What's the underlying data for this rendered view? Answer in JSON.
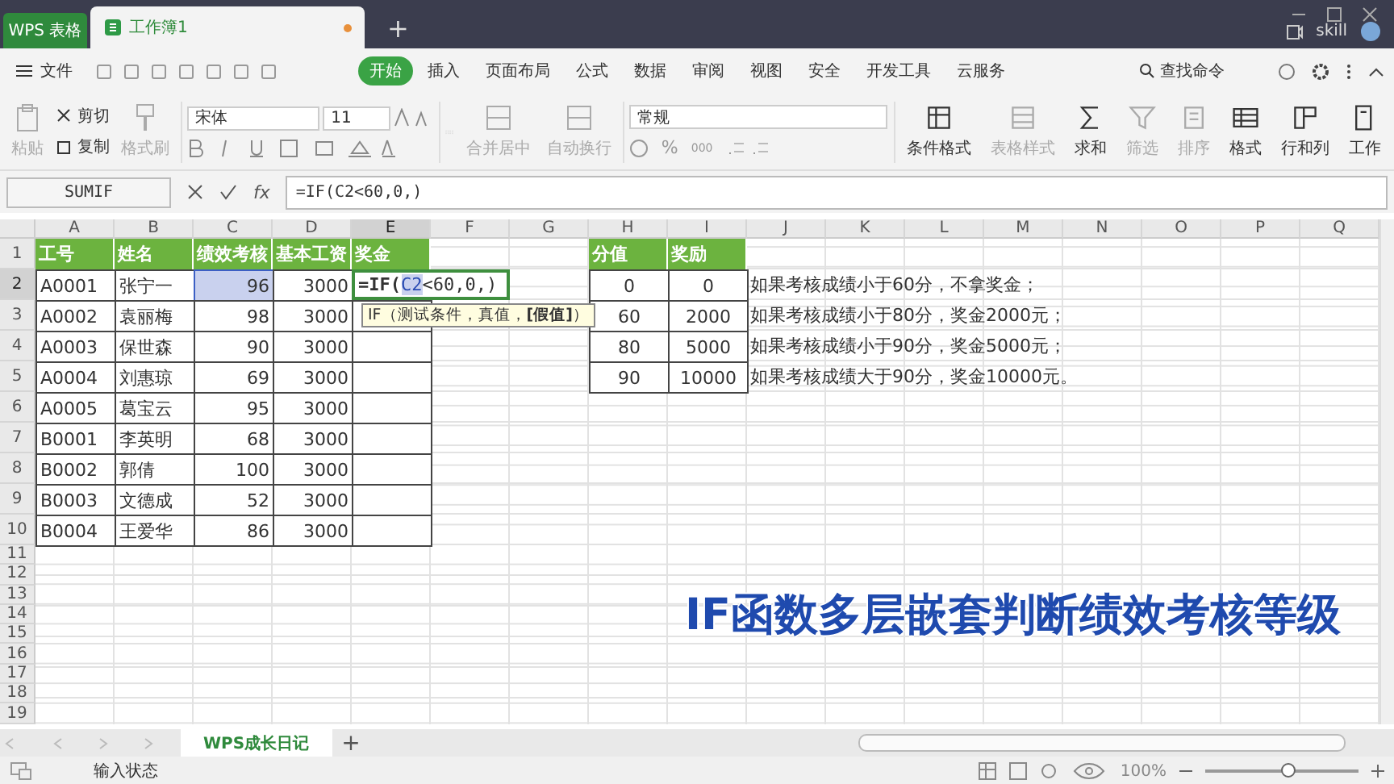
{
  "title_bar": {
    "app_tab": "WPS 表格",
    "doc_tab": {
      "label": "工作簿1",
      "unsaved": true
    },
    "new_tab": "+",
    "user": "skill"
  },
  "menu_bar": {
    "file": "文件",
    "tabs": [
      {
        "label": "开始",
        "selected": true
      },
      {
        "label": "插入",
        "selected": false
      },
      {
        "label": "页面布局",
        "selected": false
      },
      {
        "label": "公式",
        "selected": false
      },
      {
        "label": "数据",
        "selected": false
      },
      {
        "label": "审阅",
        "selected": false
      },
      {
        "label": "视图",
        "selected": false
      },
      {
        "label": "安全",
        "selected": false
      },
      {
        "label": "开发工具",
        "selected": false
      },
      {
        "label": "云服务",
        "selected": false
      }
    ],
    "search": "查找命令"
  },
  "ribbon": {
    "clipboard": [
      {
        "label": "粘贴",
        "disabled": true
      },
      {
        "label": "剪切",
        "disabled": false
      },
      {
        "label": "复制",
        "disabled": false
      },
      {
        "label": "格式刷",
        "disabled": true
      }
    ],
    "font_name": "宋体",
    "font_size": "11",
    "alignment": [
      {
        "label": "合并居中",
        "disabled": true
      },
      {
        "label": "自动换行",
        "disabled": true
      }
    ],
    "number_format": "常规",
    "percent": "%",
    "thousands": "000",
    "tools": [
      {
        "label": "条件格式",
        "disabled": false
      },
      {
        "label": "表格样式",
        "disabled": true
      },
      {
        "label": "求和",
        "disabled": false
      },
      {
        "label": "筛选",
        "disabled": true
      },
      {
        "label": "排序",
        "disabled": true
      },
      {
        "label": "格式",
        "disabled": false
      },
      {
        "label": "行和列",
        "disabled": false
      },
      {
        "label": "工作",
        "disabled": false
      }
    ]
  },
  "formula_bar": {
    "name_box": "SUMIF",
    "fx": "fx",
    "formula": "=IF(C2<60,0,)"
  },
  "sheet": {
    "columns": [
      {
        "label": "A",
        "selected": false
      },
      {
        "label": "B",
        "selected": false
      },
      {
        "label": "C",
        "selected": false
      },
      {
        "label": "D",
        "selected": false
      },
      {
        "label": "E",
        "selected": true
      },
      {
        "label": "F",
        "selected": false
      },
      {
        "label": "G",
        "selected": false
      },
      {
        "label": "H",
        "selected": false
      },
      {
        "label": "I",
        "selected": false
      },
      {
        "label": "J",
        "selected": false
      },
      {
        "label": "K",
        "selected": false
      },
      {
        "label": "L",
        "selected": false
      },
      {
        "label": "M",
        "selected": false
      },
      {
        "label": "N",
        "selected": false
      },
      {
        "label": "O",
        "selected": false
      },
      {
        "label": "P",
        "selected": false
      },
      {
        "label": "Q",
        "selected": false
      }
    ],
    "row_numbers": [
      {
        "label": "1",
        "selected": false
      },
      {
        "label": "2",
        "selected": true
      },
      {
        "label": "3",
        "selected": false
      },
      {
        "label": "4",
        "selected": false
      },
      {
        "label": "5",
        "selected": false
      },
      {
        "label": "6",
        "selected": false
      },
      {
        "label": "7",
        "selected": false
      },
      {
        "label": "8",
        "selected": false
      },
      {
        "label": "9",
        "selected": false
      },
      {
        "label": "10",
        "selected": false
      },
      {
        "label": "11",
        "selected": false
      },
      {
        "label": "12",
        "selected": false
      },
      {
        "label": "13",
        "selected": false
      },
      {
        "label": "14",
        "selected": false
      },
      {
        "label": "15",
        "selected": false
      },
      {
        "label": "16",
        "selected": false
      },
      {
        "label": "17",
        "selected": false
      },
      {
        "label": "18",
        "selected": false
      },
      {
        "label": "19",
        "selected": false
      }
    ],
    "main_table": {
      "header": [
        "工号",
        "姓名",
        "绩效考核",
        "基本工资",
        "奖金"
      ],
      "rows": [
        {
          "id": "A0001",
          "name": "张宁一",
          "score": "96",
          "salary": "3000",
          "score_selected": true
        },
        {
          "id": "A0002",
          "name": "袁丽梅",
          "score": "98",
          "salary": "3000",
          "score_selected": false
        },
        {
          "id": "A0003",
          "name": "保世森",
          "score": "90",
          "salary": "3000",
          "score_selected": false
        },
        {
          "id": "A0004",
          "name": "刘惠琼",
          "score": "69",
          "salary": "3000",
          "score_selected": false
        },
        {
          "id": "A0005",
          "name": "葛宝云",
          "score": "95",
          "salary": "3000",
          "score_selected": false
        },
        {
          "id": "B0001",
          "name": "李英明",
          "score": "68",
          "salary": "3000",
          "score_selected": false
        },
        {
          "id": "B0002",
          "name": "郭倩",
          "score": "100",
          "salary": "3000",
          "score_selected": false
        },
        {
          "id": "B0003",
          "name": "文德成",
          "score": "52",
          "salary": "3000",
          "score_selected": false
        },
        {
          "id": "B0004",
          "name": "王爱华",
          "score": "86",
          "salary": "3000",
          "score_selected": false
        }
      ],
      "editing_cell": {
        "prefix": "=IF(",
        "reference": "C2",
        "suffix": "<60,0,)"
      },
      "tooltip": "IF（测试条件，真值，**[假值]**）"
    },
    "score_table": {
      "header": [
        "分值",
        "奖励"
      ],
      "rows": [
        [
          "0",
          "0"
        ],
        [
          "60",
          "2000"
        ],
        [
          "80",
          "5000"
        ],
        [
          "90",
          "10000"
        ]
      ]
    },
    "notes": [
      "如果考核成绩小于60分，不拿奖金；",
      "如果考核成绩小于80分，奖金2000元；",
      "如果考核成绩小于90分，奖金5000元；",
      "如果考核成绩大于90分，奖金10000元。"
    ],
    "caption": "IF函数多层嵌套判断绩效考核等级"
  },
  "sheet_tabs": {
    "tabs": [
      {
        "label": "WPS成长日记",
        "selected": true
      }
    ],
    "add": "+"
  },
  "status_bar": {
    "mode": "输入状态",
    "zoom": "100%",
    "zoom_slider": {
      "level": 0.55
    }
  }
}
